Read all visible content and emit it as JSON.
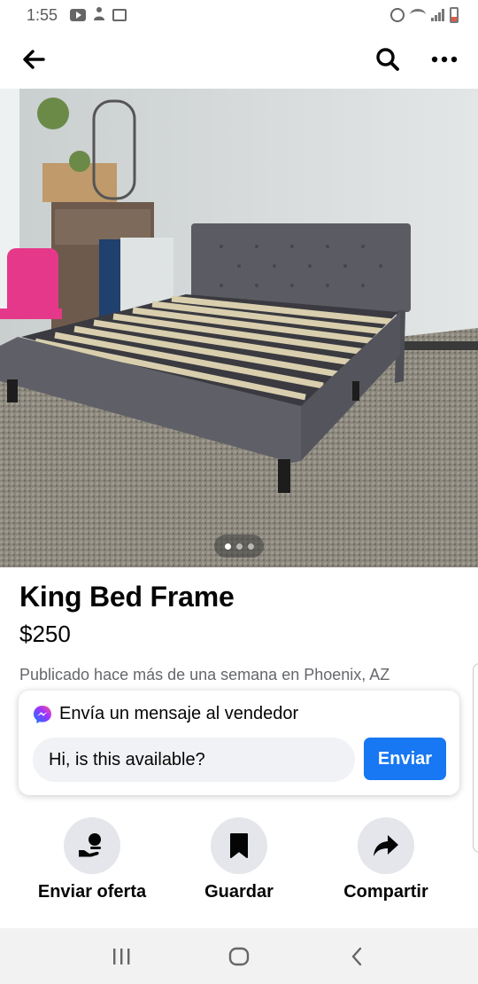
{
  "status_bar": {
    "time": "1:55",
    "left_icons": [
      "youtube-icon",
      "person-icon",
      "gallery-icon"
    ],
    "right_icons": [
      "alarm-icon",
      "wifi-icon",
      "signal-icon",
      "battery-icon"
    ]
  },
  "top_nav": {
    "icons": [
      "back-arrow-icon",
      "search-icon",
      "more-icon"
    ]
  },
  "photo": {
    "subject": "bed-frame-photo",
    "carousel": {
      "count": 3,
      "active_index": 0
    }
  },
  "listing": {
    "title": "King Bed Frame",
    "price": "$250",
    "posted": "Publicado hace más de una semana en Phoenix, AZ"
  },
  "message_card": {
    "title": "Envía un mensaje al vendedor",
    "input_value": "Hi, is this available?",
    "send_label": "Enviar"
  },
  "actions": [
    {
      "label": "Enviar oferta",
      "icon": "make-offer-icon"
    },
    {
      "label": "Guardar",
      "icon": "bookmark-icon"
    },
    {
      "label": "Compartir",
      "icon": "share-icon"
    }
  ],
  "android_nav": {
    "icons": [
      "recent-apps-icon",
      "home-icon",
      "back-icon"
    ]
  },
  "colors": {
    "accent": "#1877f2",
    "text_primary": "#050505",
    "text_secondary": "#65676b",
    "action_circle": "#e4e6eb",
    "input_bg": "#f0f2f5"
  }
}
